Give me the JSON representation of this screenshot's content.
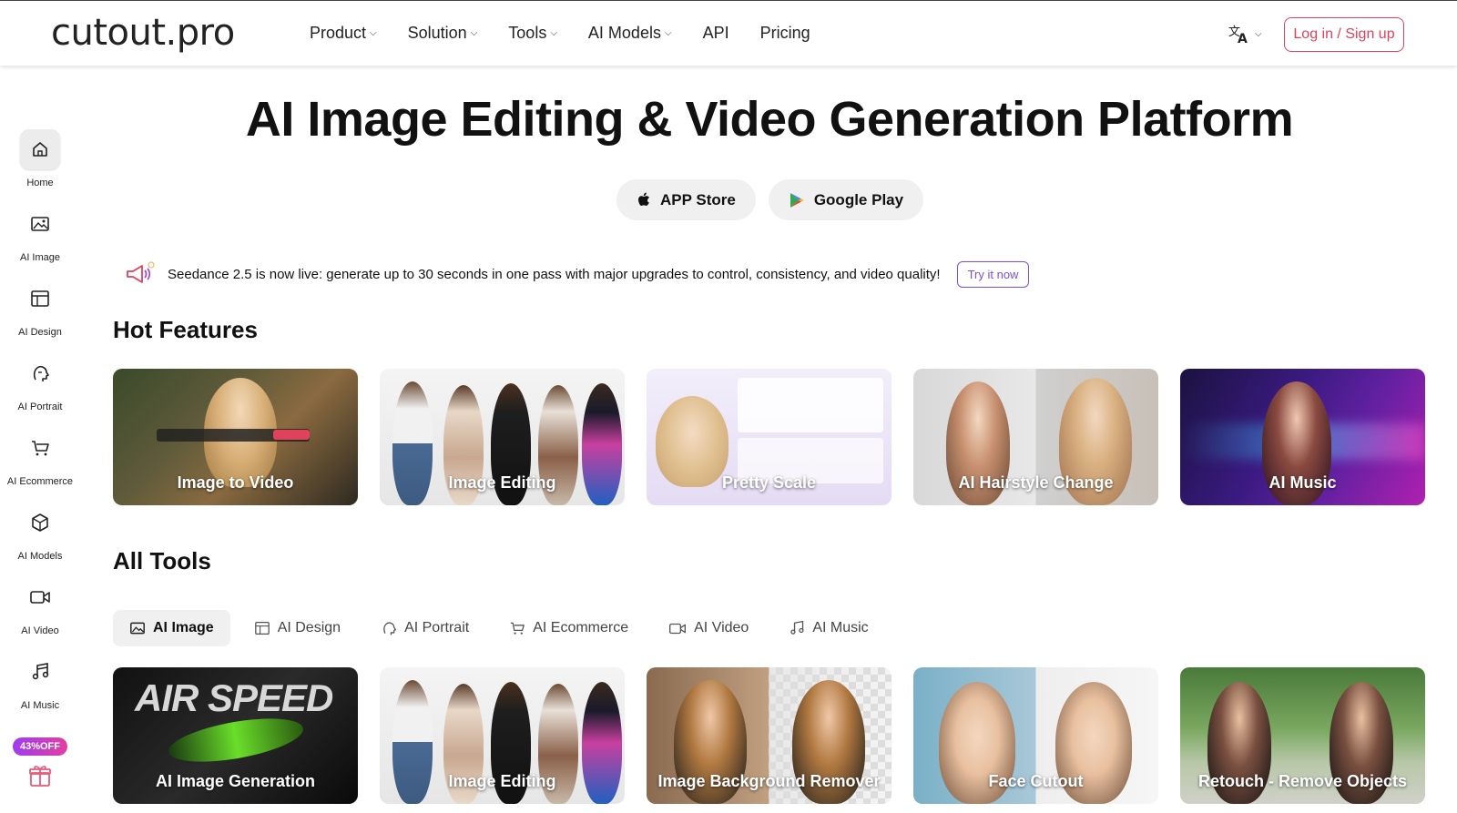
{
  "header": {
    "logo": "cutout.pro",
    "nav": [
      {
        "label": "Product",
        "dropdown": true
      },
      {
        "label": "Solution",
        "dropdown": true
      },
      {
        "label": "Tools",
        "dropdown": true
      },
      {
        "label": "AI Models",
        "dropdown": true
      },
      {
        "label": "API",
        "dropdown": false
      },
      {
        "label": "Pricing",
        "dropdown": false
      }
    ],
    "language_icon": "translate-icon",
    "login_label": "Log in / Sign up"
  },
  "sidebar": {
    "items": [
      {
        "label": "Home",
        "icon": "home-icon",
        "active": true
      },
      {
        "label": "AI Image",
        "icon": "image-icon",
        "active": false
      },
      {
        "label": "AI Design",
        "icon": "layout-icon",
        "active": false
      },
      {
        "label": "AI Portrait",
        "icon": "portrait-icon",
        "active": false
      },
      {
        "label": "AI Ecommerce",
        "icon": "cart-icon",
        "active": false
      },
      {
        "label": "AI Models",
        "icon": "cube-icon",
        "active": false
      },
      {
        "label": "AI Video",
        "icon": "video-icon",
        "active": false
      },
      {
        "label": "AI Music",
        "icon": "music-icon",
        "active": false
      }
    ],
    "promo_badge": "43%OFF",
    "gift_icon": "gift-icon"
  },
  "hero": {
    "title": "AI Image Editing & Video Generation Platform",
    "app_store_label": "APP Store",
    "google_play_label": "Google Play"
  },
  "announcement": {
    "text": "Seedance 2.5 is now live: generate up to 30 seconds in one pass with major upgrades to control, consistency, and video quality!",
    "cta": "Try it now"
  },
  "hot_features": {
    "title": "Hot Features",
    "cards": [
      {
        "caption": "Image to Video"
      },
      {
        "caption": "Image Editing"
      },
      {
        "caption": "Pretty Scale"
      },
      {
        "caption": "AI Hairstyle Change"
      },
      {
        "caption": "AI Music"
      }
    ]
  },
  "all_tools": {
    "title": "All Tools",
    "tabs": [
      {
        "label": "AI Image",
        "icon": "image-icon",
        "active": true
      },
      {
        "label": "AI Design",
        "icon": "layout-icon",
        "active": false
      },
      {
        "label": "AI Portrait",
        "icon": "portrait-icon",
        "active": false
      },
      {
        "label": "AI Ecommerce",
        "icon": "cart-icon",
        "active": false
      },
      {
        "label": "AI Video",
        "icon": "video-icon",
        "active": false
      },
      {
        "label": "AI Music",
        "icon": "music-icon",
        "active": false
      }
    ],
    "cards": [
      {
        "caption": "AI Image Generation"
      },
      {
        "caption": "Image Editing"
      },
      {
        "caption": "Image Background Remover"
      },
      {
        "caption": "Face Cutout"
      },
      {
        "caption": "Retouch - Remove Objects"
      }
    ]
  },
  "colors": {
    "accent_login": "#e0415b",
    "accent_try": "#7b4ee0"
  }
}
